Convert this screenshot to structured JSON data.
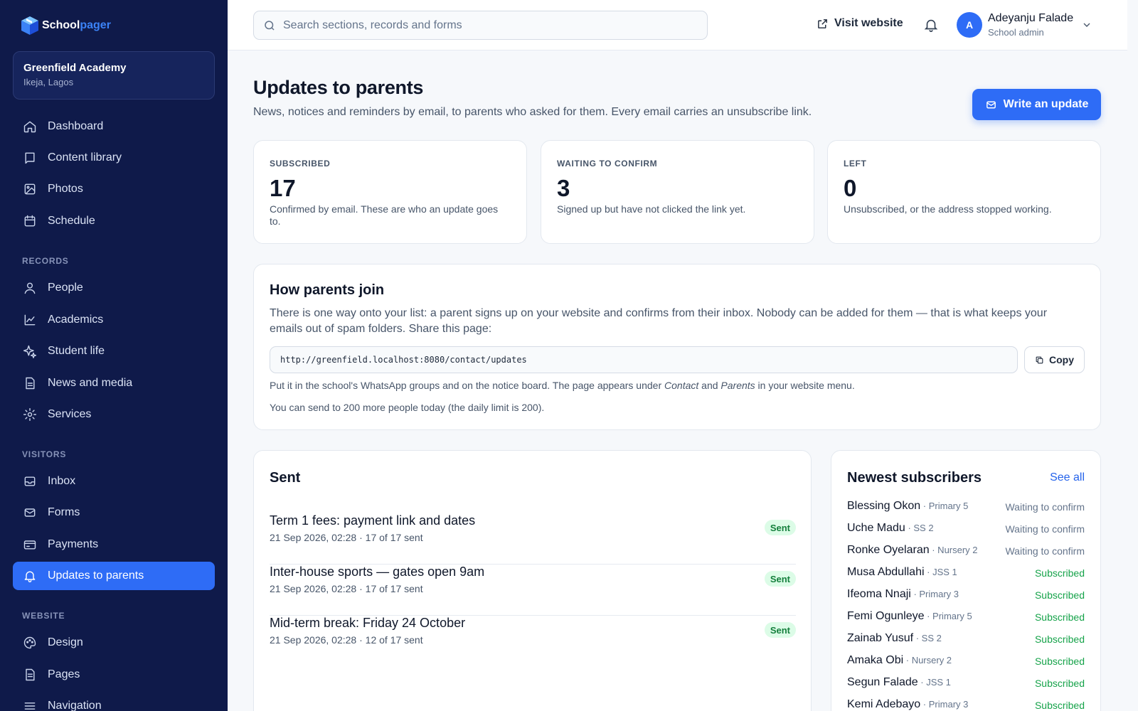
{
  "brand": {
    "name_a": "School",
    "name_b": "pager"
  },
  "school": {
    "name": "Greenfield Academy",
    "location": "Ikeja, Lagos"
  },
  "nav": {
    "main": [
      {
        "label": "Dashboard",
        "icon": "home-icon"
      },
      {
        "label": "Content library",
        "icon": "book-icon"
      },
      {
        "label": "Photos",
        "icon": "image-icon"
      },
      {
        "label": "Schedule",
        "icon": "calendar-icon"
      }
    ],
    "records_label": "RECORDS",
    "records": [
      {
        "label": "People",
        "icon": "user-icon"
      },
      {
        "label": "Academics",
        "icon": "chart-line-icon"
      },
      {
        "label": "Student life",
        "icon": "sparkle-icon"
      },
      {
        "label": "News and media",
        "icon": "document-icon"
      },
      {
        "label": "Services",
        "icon": "gear-icon"
      }
    ],
    "visitors_label": "VISITORS",
    "visitors": [
      {
        "label": "Inbox",
        "icon": "inbox-icon"
      },
      {
        "label": "Forms",
        "icon": "mail-icon"
      },
      {
        "label": "Payments",
        "icon": "card-icon"
      },
      {
        "label": "Updates to parents",
        "icon": "bell-icon",
        "active": true
      }
    ],
    "website_label": "WEBSITE",
    "website": [
      {
        "label": "Design",
        "icon": "palette-icon"
      },
      {
        "label": "Pages",
        "icon": "page-icon"
      },
      {
        "label": "Navigation",
        "icon": "menu-icon"
      }
    ]
  },
  "topbar": {
    "search_placeholder": "Search sections, records and forms",
    "visit_label": "Visit website",
    "user": {
      "initial": "A",
      "name": "Adeyanju Falade",
      "role": "School admin"
    }
  },
  "page": {
    "title": "Updates to parents",
    "subtitle": "News, notices and reminders by email, to parents who asked for them. Every email carries an unsubscribe link.",
    "write_button": "Write an update"
  },
  "stats": [
    {
      "label": "SUBSCRIBED",
      "value": "17",
      "desc": "Confirmed by email. These are who an update goes to."
    },
    {
      "label": "WAITING TO CONFIRM",
      "value": "3",
      "desc": "Signed up but have not clicked the link yet."
    },
    {
      "label": "LEFT",
      "value": "0",
      "desc": "Unsubscribed, or the address stopped working."
    }
  ],
  "join": {
    "title": "How parents join",
    "desc": "There is one way onto your list: a parent signs up on your website and confirms from their inbox. Nobody can be added for them — that is what keeps your emails out of spam folders. Share this page:",
    "url": "http://greenfield.localhost:8080/contact/updates",
    "copy_label": "Copy",
    "note_pre": "Put it in the school's WhatsApp groups and on the notice board. The page appears under ",
    "note_contact": "Contact",
    "note_and": " and ",
    "note_parents": "Parents",
    "note_post": " in your website menu.",
    "limit_note": "You can send to 200 more people today (the daily limit is 200)."
  },
  "sent": {
    "title": "Sent",
    "items": [
      {
        "title": "Term 1 fees: payment link and dates",
        "meta": "21 Sep 2026, 02:28 · 17 of 17 sent",
        "status": "Sent"
      },
      {
        "title": "Inter-house sports — gates open 9am",
        "meta": "21 Sep 2026, 02:28 · 17 of 17 sent",
        "status": "Sent"
      },
      {
        "title": "Mid-term break: Friday 24 October",
        "meta": "21 Sep 2026, 02:28 · 12 of 17 sent",
        "status": "Sent"
      }
    ]
  },
  "subscribers": {
    "title": "Newest subscribers",
    "see_all": "See all",
    "items": [
      {
        "name": "Blessing Okon",
        "class": " · Primary 5",
        "status": "Waiting to confirm",
        "ok": false
      },
      {
        "name": "Uche Madu",
        "class": " · SS 2",
        "status": "Waiting to confirm",
        "ok": false
      },
      {
        "name": "Ronke Oyelaran",
        "class": " · Nursery 2",
        "status": "Waiting to confirm",
        "ok": false
      },
      {
        "name": "Musa Abdullahi",
        "class": " · JSS 1",
        "status": "Subscribed",
        "ok": true
      },
      {
        "name": "Ifeoma Nnaji",
        "class": " · Primary 3",
        "status": "Subscribed",
        "ok": true
      },
      {
        "name": "Femi Ogunleye",
        "class": " · Primary 5",
        "status": "Subscribed",
        "ok": true
      },
      {
        "name": "Zainab Yusuf",
        "class": " · SS 2",
        "status": "Subscribed",
        "ok": true
      },
      {
        "name": "Amaka Obi",
        "class": " · Nursery 2",
        "status": "Subscribed",
        "ok": true
      },
      {
        "name": "Segun Falade",
        "class": " · JSS 1",
        "status": "Subscribed",
        "ok": true
      },
      {
        "name": "Kemi Adebayo",
        "class": " · Primary 3",
        "status": "Subscribed",
        "ok": true
      }
    ]
  },
  "colors": {
    "sidebar": "#0f1a4a",
    "accent": "#2e6cf6",
    "success": "#16a34a"
  }
}
